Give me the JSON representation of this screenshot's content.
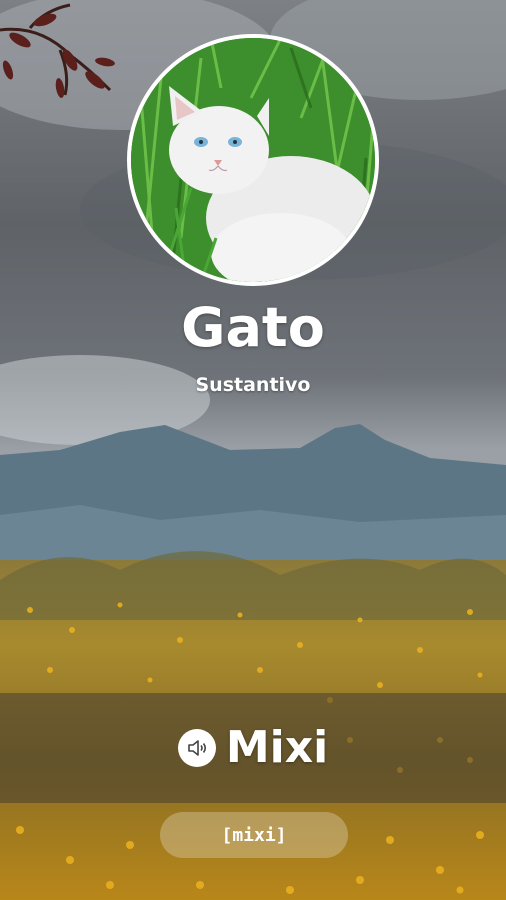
{
  "card": {
    "word": "Gato",
    "part_of_speech": "Sustantivo",
    "translation": "Mixi",
    "pronunciation": "[mixi]"
  },
  "icons": {
    "speaker": "speaker-icon"
  },
  "colors": {
    "text": "#ffffff",
    "avatar_border": "#ffffff"
  }
}
